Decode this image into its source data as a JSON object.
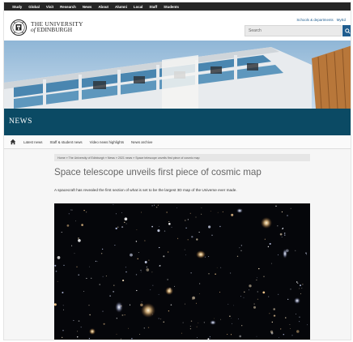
{
  "top_nav": [
    "Study",
    "Global",
    "Visit",
    "Research",
    "News",
    "About",
    "Alumni",
    "Local",
    "Staff",
    "Students"
  ],
  "header": {
    "name_line1": "THE UNIVERSITY",
    "name_line2_prefix": "of",
    "name_line2": "EDINBURGH",
    "util_links": [
      "Schools & departments",
      "MyEd"
    ],
    "search_placeholder": "Search"
  },
  "section_title": "NEWS",
  "subnav": [
    "Latest news",
    "Staff & student news",
    "Video news highlights",
    "News archive"
  ],
  "breadcrumb": "Home  »  The University of Edinburgh  »  News  »  2021 news  »  Space telescope unveils first piece of cosmic map",
  "article": {
    "title": "Space telescope unveils first piece of cosmic map",
    "standfirst": "A spacecraft has revealed the first section of what is set to be the largest 3D map of the Universe ever made."
  },
  "colors": {
    "top_bar": "#262626",
    "brand_blue": "#1f5d8f",
    "news_strip": "#0b4a64"
  },
  "icons": {
    "crest": "university-crest-icon",
    "search": "search-icon",
    "home": "home-icon"
  }
}
